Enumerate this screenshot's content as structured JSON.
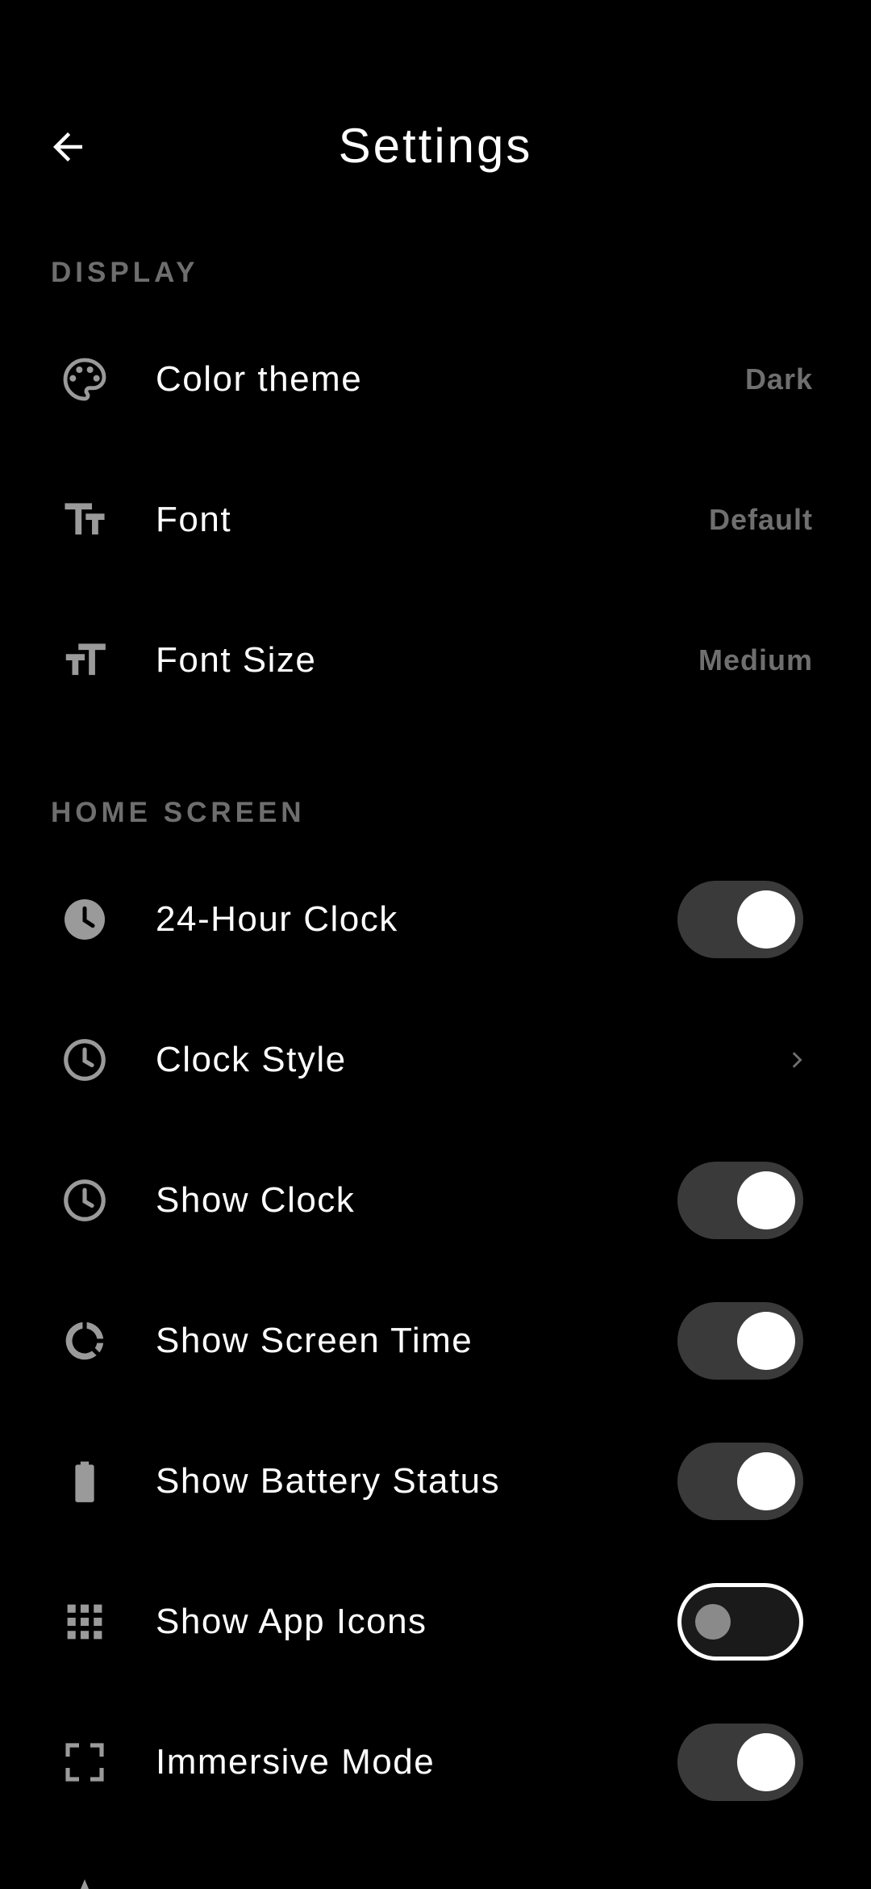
{
  "header": {
    "title": "Settings",
    "back_icon": "arrow-back-icon"
  },
  "sections": {
    "display": {
      "title": "DISPLAY",
      "items": [
        {
          "label": "Color theme",
          "value": "Dark",
          "icon": "palette-icon"
        },
        {
          "label": "Font",
          "value": "Default",
          "icon": "text-fields-icon"
        },
        {
          "label": "Font Size",
          "value": "Medium",
          "icon": "format-size-icon"
        }
      ]
    },
    "home_screen": {
      "title": "HOME SCREEN",
      "items": [
        {
          "label": "24-Hour Clock",
          "icon": "clock-filled-icon",
          "toggle": true
        },
        {
          "label": "Clock Style",
          "icon": "clock-outline-icon",
          "chevron": "chevron-right-icon"
        },
        {
          "label": "Show Clock",
          "icon": "clock-outline-icon",
          "toggle": true
        },
        {
          "label": "Show Screen Time",
          "icon": "donut-icon",
          "toggle": true
        },
        {
          "label": "Show Battery Status",
          "icon": "battery-icon",
          "toggle": true
        },
        {
          "label": "Show App Icons",
          "icon": "apps-grid-icon",
          "toggle": false
        },
        {
          "label": "Immersive Mode",
          "icon": "fullscreen-icon",
          "toggle": true
        }
      ]
    }
  },
  "colors": {
    "background": "#000000",
    "text": "#ffffff",
    "muted": "#6e6e6e",
    "toggle_track_on": "#3a3a3a",
    "toggle_knob": "#ffffff"
  }
}
